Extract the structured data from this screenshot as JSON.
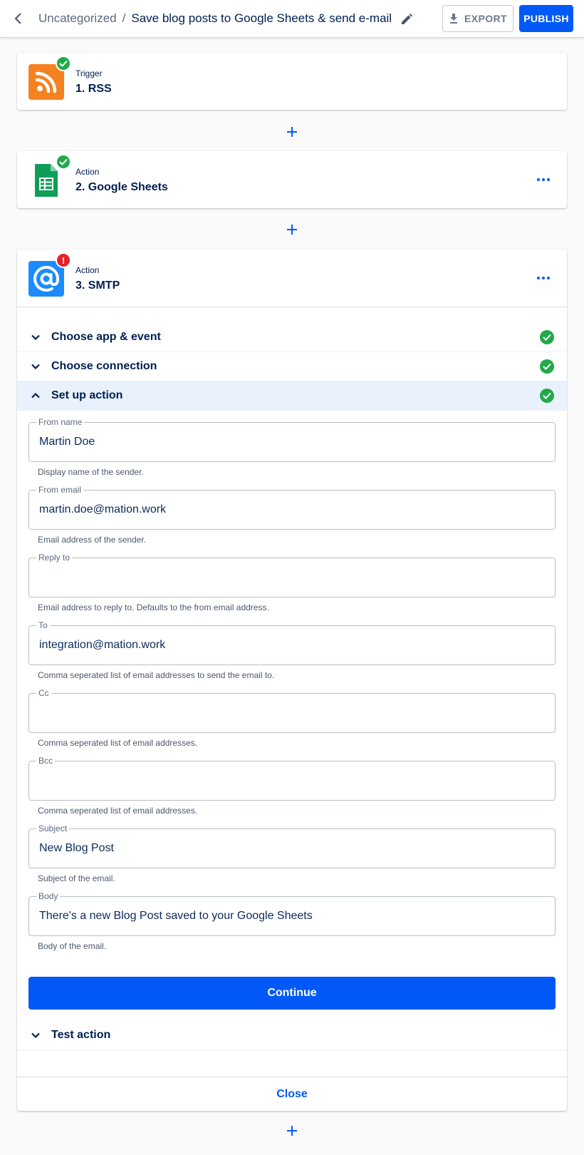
{
  "header": {
    "breadcrumb_category": "Uncategorized",
    "breadcrumb_separator": "/",
    "flow_name": "Save blog posts to Google Sheets & send e-mail",
    "export_label": "EXPORT",
    "publish_label": "PUBLISH"
  },
  "steps": [
    {
      "type": "Trigger",
      "name": "1. RSS",
      "app_icon": "rss-icon",
      "status": "success"
    },
    {
      "type": "Action",
      "name": "2. Google Sheets",
      "app_icon": "google-sheets-icon",
      "status": "success"
    },
    {
      "type": "Action",
      "name": "3. SMTP",
      "app_icon": "at-sign-icon",
      "status": "error",
      "error_mark": "!"
    }
  ],
  "sections": {
    "choose_app": "Choose app & event",
    "choose_connection": "Choose connection",
    "setup_action": "Set up action",
    "test_action": "Test action"
  },
  "fields": [
    {
      "label": "From name",
      "value": "Martin Doe",
      "help": "Display name of the sender."
    },
    {
      "label": "From email",
      "value": "martin.doe@mation.work",
      "help": "Email address of the sender."
    },
    {
      "label": "Reply to",
      "value": "",
      "help": "Email address to reply to. Defaults to the from email address."
    },
    {
      "label": "To",
      "value": "integration@mation.work",
      "help": "Comma seperated list of email addresses to send the email to."
    },
    {
      "label": "Cc",
      "value": "",
      "help": "Comma seperated list of email addresses."
    },
    {
      "label": "Bcc",
      "value": "",
      "help": "Comma seperated list of email addresses."
    },
    {
      "label": "Subject",
      "value": "New Blog Post",
      "help": "Subject of the email."
    },
    {
      "label": "Body",
      "value": "There's a new Blog Post saved to your Google Sheets",
      "help": "Body of the email."
    }
  ],
  "continue_label": "Continue",
  "close_label": "Close",
  "colors": {
    "primary": "#0059f7",
    "success": "#22a94a",
    "error": "#e5222a",
    "rss": "#f58220",
    "sheets": "#0f9d58",
    "smtp": "#1a8cff",
    "active_section": "#e8f1fc"
  }
}
